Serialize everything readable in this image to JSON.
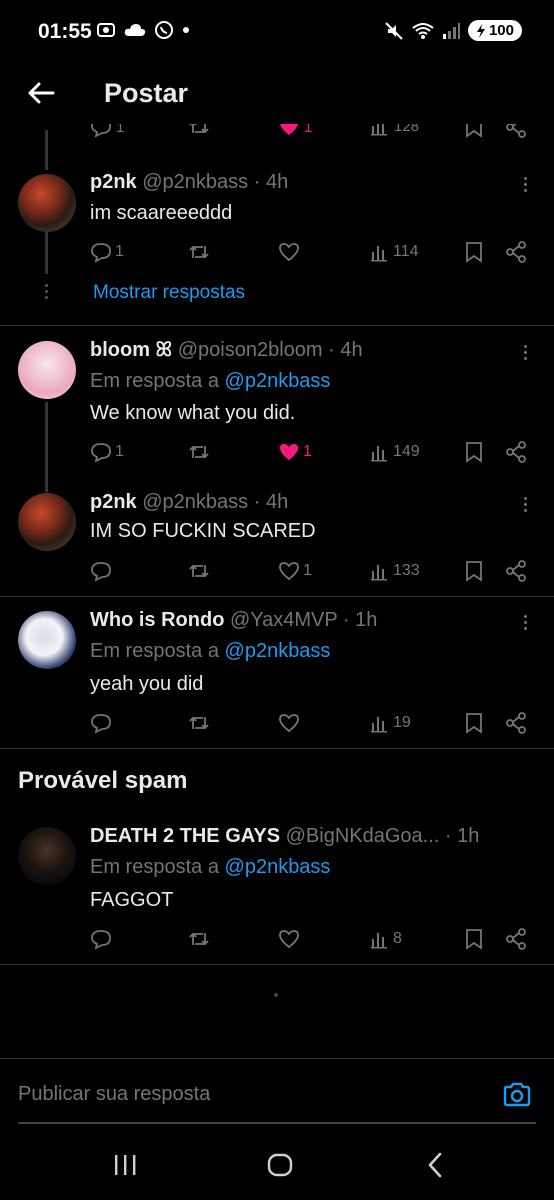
{
  "status_bar": {
    "time": "01:55",
    "battery": "100"
  },
  "header": {
    "title": "Postar"
  },
  "cut_row": {
    "reply_count": "1",
    "like_count": "1",
    "view_count": "128"
  },
  "tweets": [
    {
      "name": "p2nk",
      "handle": "@p2nkbass · 4h",
      "text": "im scaareeeddd",
      "replies": "1",
      "retweets": "",
      "likes": "",
      "views": "114",
      "liked": false
    },
    {
      "name": "bloom ꕤ",
      "handle": "@poison2bloom · 4h",
      "reply_prefix": "Em resposta a ",
      "reply_to": "@p2nkbass",
      "text": "We know what you did.",
      "replies": "1",
      "retweets": "",
      "likes": "1",
      "views": "149",
      "liked": true
    },
    {
      "name": "p2nk",
      "handle": "@p2nkbass · 4h",
      "text": "IM SO FUCKIN SCARED",
      "replies": "",
      "retweets": "",
      "likes": "1",
      "views": "133",
      "liked": false
    },
    {
      "name": "Who is Rondo",
      "handle": "@Yax4MVP · 1h",
      "reply_prefix": "Em resposta a ",
      "reply_to": "@p2nkbass",
      "text": "yeah you did",
      "replies": "",
      "retweets": "",
      "likes": "",
      "views": "19",
      "liked": false
    },
    {
      "name": "DEATH 2 THE GAYS",
      "handle": "@BigNKdaGoa... · 1h",
      "reply_prefix": "Em resposta a ",
      "reply_to": "@p2nkbass",
      "text": "FAGGOT",
      "replies": "",
      "retweets": "",
      "likes": "",
      "views": "8",
      "liked": false
    }
  ],
  "show_replies_label": "Mostrar respostas",
  "spam_section_title": "Provável spam",
  "composer": {
    "placeholder": "Publicar sua resposta"
  },
  "colors": {
    "accent": "#1d9bf0",
    "like": "#f91880",
    "muted": "#71767b",
    "background": "#000000"
  },
  "icons": [
    "back-arrow-icon",
    "reply-icon",
    "retweet-icon",
    "heart-icon",
    "views-icon",
    "bookmark-icon",
    "share-icon",
    "more-icon",
    "camera-icon"
  ]
}
